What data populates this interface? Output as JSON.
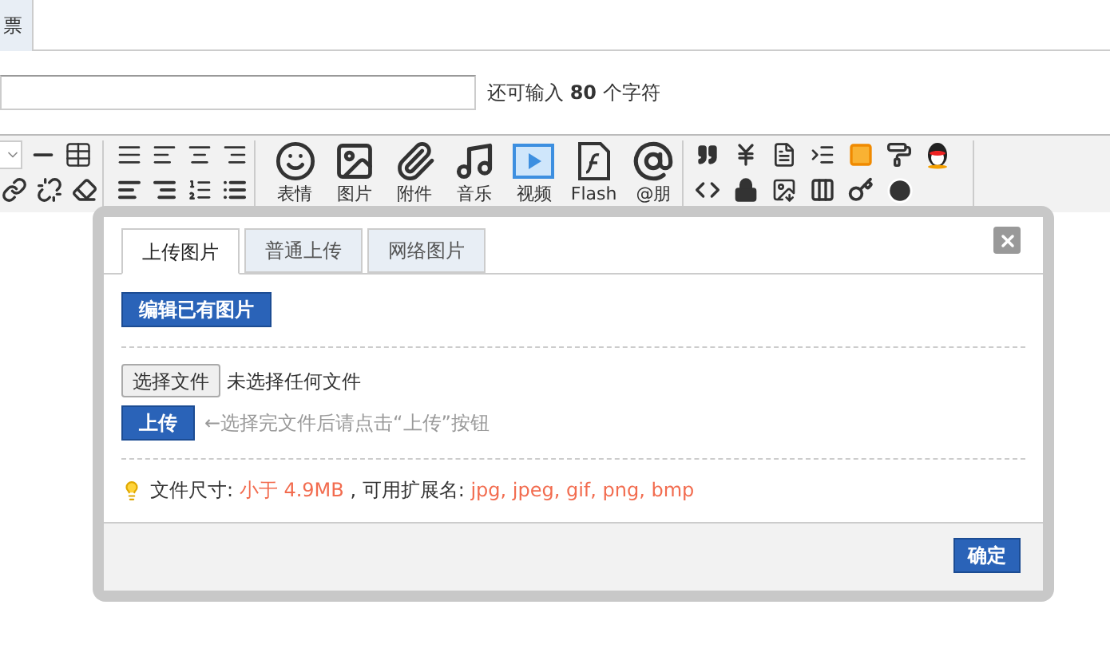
{
  "top_tabs": [
    {
      "label": "票"
    }
  ],
  "title_row": {
    "counter_prefix": "还可输入",
    "counter_value": "80",
    "counter_suffix": "个字符"
  },
  "toolbar": {
    "media_buttons": [
      {
        "kind": "smile",
        "label": "表情"
      },
      {
        "kind": "image",
        "label": "图片"
      },
      {
        "kind": "attach",
        "label": "附件"
      },
      {
        "kind": "music",
        "label": "音乐"
      },
      {
        "kind": "video",
        "label": "视频"
      },
      {
        "kind": "flash",
        "label": "Flash"
      },
      {
        "kind": "at",
        "label": "@朋"
      }
    ]
  },
  "dialog": {
    "tabs": [
      {
        "label": "上传图片",
        "selected": true
      },
      {
        "label": "普通上传",
        "selected": false
      },
      {
        "label": "网络图片",
        "selected": false
      }
    ],
    "edit_button": "编辑已有图片",
    "file_button": "选择文件",
    "file_status": "未选择任何文件",
    "upload_button": "上传",
    "upload_hint": "←选择完文件后请点击“上传”按钮",
    "info": {
      "size_label": "文件尺寸:",
      "size_value": "小于 4.9MB",
      "ext_label": ", 可用扩展名:",
      "ext_value": "jpg, jpeg, gif, png, bmp"
    },
    "confirm_button": "确定"
  }
}
